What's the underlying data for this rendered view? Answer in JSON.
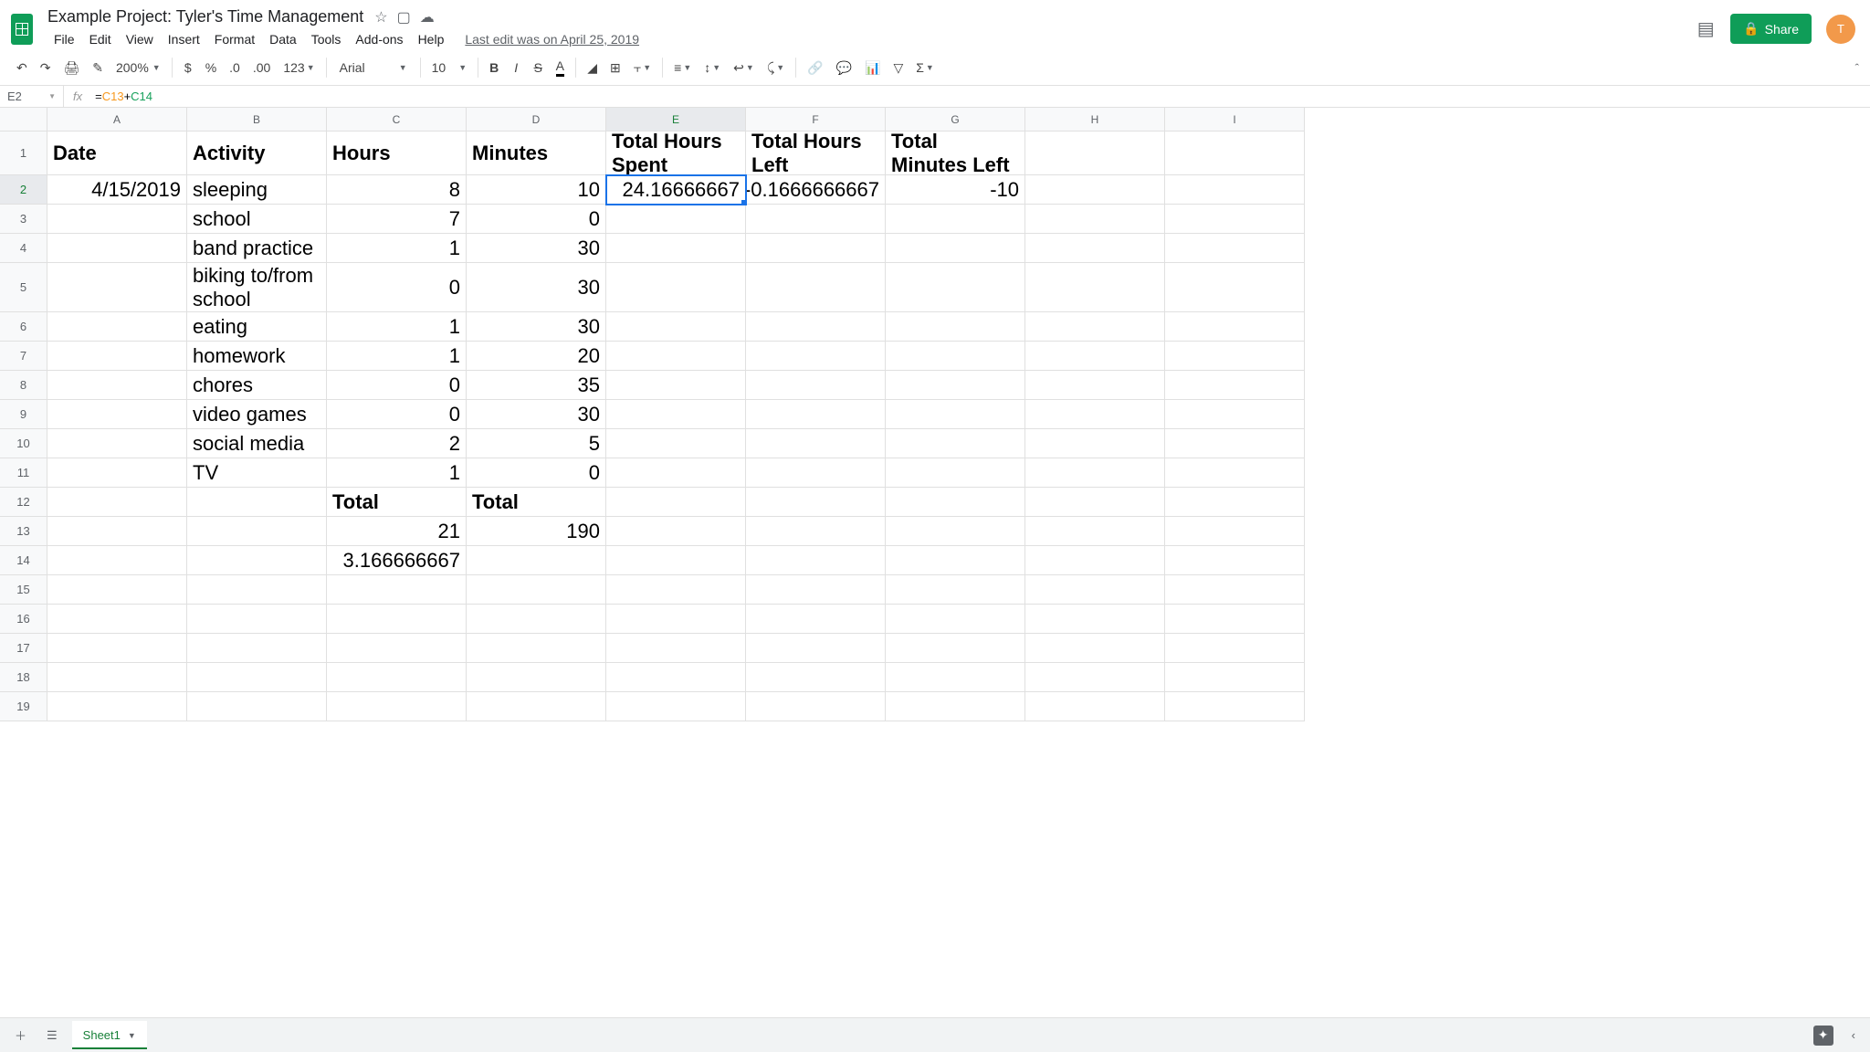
{
  "doc_title": "Example Project: Tyler's Time Management",
  "edit_info": "Last edit was on April 25, 2019",
  "menus": [
    "File",
    "Edit",
    "View",
    "Insert",
    "Format",
    "Data",
    "Tools",
    "Add-ons",
    "Help"
  ],
  "toolbar": {
    "zoom": "200%",
    "font": "Arial",
    "size": "10",
    "fmt": "123"
  },
  "name_box": "E2",
  "formula": {
    "p1": "=",
    "c1": "C13",
    "op": "+",
    "c2": "C14"
  },
  "share_label": "Share",
  "avatar_letter": "T",
  "columns": [
    "A",
    "B",
    "C",
    "D",
    "E",
    "F",
    "G",
    "H",
    "I"
  ],
  "rows": [
    {
      "n": 1,
      "h": "med",
      "cells": [
        {
          "v": "Date",
          "cls": "bold"
        },
        {
          "v": "Activity",
          "cls": "bold"
        },
        {
          "v": "Hours",
          "cls": "bold"
        },
        {
          "v": "Minutes",
          "cls": "bold"
        },
        {
          "v": "Total Hours Spent",
          "cls": "bold wrap"
        },
        {
          "v": "Total Hours Left",
          "cls": "bold wrap"
        },
        {
          "v": "Total Minutes Left",
          "cls": "bold wrap"
        },
        {
          "v": ""
        },
        {
          "v": ""
        }
      ]
    },
    {
      "n": 2,
      "cells": [
        {
          "v": "4/15/2019",
          "cls": "right"
        },
        {
          "v": "sleeping"
        },
        {
          "v": "8",
          "cls": "right"
        },
        {
          "v": "10",
          "cls": "right"
        },
        {
          "v": "24.16666667",
          "cls": "right",
          "sel": true
        },
        {
          "v": "-0.1666666667",
          "cls": "right"
        },
        {
          "v": "-10",
          "cls": "right"
        },
        {
          "v": ""
        },
        {
          "v": ""
        }
      ]
    },
    {
      "n": 3,
      "cells": [
        {
          "v": ""
        },
        {
          "v": "school"
        },
        {
          "v": "7",
          "cls": "right"
        },
        {
          "v": "0",
          "cls": "right"
        },
        {
          "v": ""
        },
        {
          "v": ""
        },
        {
          "v": ""
        },
        {
          "v": ""
        },
        {
          "v": ""
        }
      ]
    },
    {
      "n": 4,
      "cells": [
        {
          "v": ""
        },
        {
          "v": "band practice"
        },
        {
          "v": "1",
          "cls": "right"
        },
        {
          "v": "30",
          "cls": "right"
        },
        {
          "v": ""
        },
        {
          "v": ""
        },
        {
          "v": ""
        },
        {
          "v": ""
        },
        {
          "v": ""
        }
      ]
    },
    {
      "n": 5,
      "h": "tall",
      "cells": [
        {
          "v": ""
        },
        {
          "v": "biking to/from school",
          "cls": "wrap"
        },
        {
          "v": "0",
          "cls": "right"
        },
        {
          "v": "30",
          "cls": "right"
        },
        {
          "v": ""
        },
        {
          "v": ""
        },
        {
          "v": ""
        },
        {
          "v": ""
        },
        {
          "v": ""
        }
      ]
    },
    {
      "n": 6,
      "cells": [
        {
          "v": ""
        },
        {
          "v": "eating"
        },
        {
          "v": "1",
          "cls": "right"
        },
        {
          "v": "30",
          "cls": "right"
        },
        {
          "v": ""
        },
        {
          "v": ""
        },
        {
          "v": ""
        },
        {
          "v": ""
        },
        {
          "v": ""
        }
      ]
    },
    {
      "n": 7,
      "cells": [
        {
          "v": ""
        },
        {
          "v": "homework"
        },
        {
          "v": "1",
          "cls": "right"
        },
        {
          "v": "20",
          "cls": "right"
        },
        {
          "v": ""
        },
        {
          "v": ""
        },
        {
          "v": ""
        },
        {
          "v": ""
        },
        {
          "v": ""
        }
      ]
    },
    {
      "n": 8,
      "cells": [
        {
          "v": ""
        },
        {
          "v": "chores"
        },
        {
          "v": "0",
          "cls": "right"
        },
        {
          "v": "35",
          "cls": "right"
        },
        {
          "v": ""
        },
        {
          "v": ""
        },
        {
          "v": ""
        },
        {
          "v": ""
        },
        {
          "v": ""
        }
      ]
    },
    {
      "n": 9,
      "cells": [
        {
          "v": ""
        },
        {
          "v": "video games"
        },
        {
          "v": "0",
          "cls": "right"
        },
        {
          "v": "30",
          "cls": "right"
        },
        {
          "v": ""
        },
        {
          "v": ""
        },
        {
          "v": ""
        },
        {
          "v": ""
        },
        {
          "v": ""
        }
      ]
    },
    {
      "n": 10,
      "cells": [
        {
          "v": ""
        },
        {
          "v": "social media"
        },
        {
          "v": "2",
          "cls": "right"
        },
        {
          "v": "5",
          "cls": "right"
        },
        {
          "v": ""
        },
        {
          "v": ""
        },
        {
          "v": ""
        },
        {
          "v": ""
        },
        {
          "v": ""
        }
      ]
    },
    {
      "n": 11,
      "cells": [
        {
          "v": ""
        },
        {
          "v": "TV"
        },
        {
          "v": "1",
          "cls": "right"
        },
        {
          "v": "0",
          "cls": "right"
        },
        {
          "v": ""
        },
        {
          "v": ""
        },
        {
          "v": ""
        },
        {
          "v": ""
        },
        {
          "v": ""
        }
      ]
    },
    {
      "n": 12,
      "cells": [
        {
          "v": ""
        },
        {
          "v": ""
        },
        {
          "v": "Total",
          "cls": "bold"
        },
        {
          "v": "Total",
          "cls": "bold"
        },
        {
          "v": ""
        },
        {
          "v": ""
        },
        {
          "v": ""
        },
        {
          "v": ""
        },
        {
          "v": ""
        }
      ]
    },
    {
      "n": 13,
      "cells": [
        {
          "v": ""
        },
        {
          "v": ""
        },
        {
          "v": "21",
          "cls": "right"
        },
        {
          "v": "190",
          "cls": "right"
        },
        {
          "v": ""
        },
        {
          "v": ""
        },
        {
          "v": ""
        },
        {
          "v": ""
        },
        {
          "v": ""
        }
      ]
    },
    {
      "n": 14,
      "cells": [
        {
          "v": ""
        },
        {
          "v": ""
        },
        {
          "v": "3.166666667",
          "cls": "right"
        },
        {
          "v": ""
        },
        {
          "v": ""
        },
        {
          "v": ""
        },
        {
          "v": ""
        },
        {
          "v": ""
        },
        {
          "v": ""
        }
      ]
    },
    {
      "n": 15,
      "cells": [
        {
          "v": ""
        },
        {
          "v": ""
        },
        {
          "v": ""
        },
        {
          "v": ""
        },
        {
          "v": ""
        },
        {
          "v": ""
        },
        {
          "v": ""
        },
        {
          "v": ""
        },
        {
          "v": ""
        }
      ]
    },
    {
      "n": 16,
      "cells": [
        {
          "v": ""
        },
        {
          "v": ""
        },
        {
          "v": ""
        },
        {
          "v": ""
        },
        {
          "v": ""
        },
        {
          "v": ""
        },
        {
          "v": ""
        },
        {
          "v": ""
        },
        {
          "v": ""
        }
      ]
    },
    {
      "n": 17,
      "cells": [
        {
          "v": ""
        },
        {
          "v": ""
        },
        {
          "v": ""
        },
        {
          "v": ""
        },
        {
          "v": ""
        },
        {
          "v": ""
        },
        {
          "v": ""
        },
        {
          "v": ""
        },
        {
          "v": ""
        }
      ]
    },
    {
      "n": 18,
      "cells": [
        {
          "v": ""
        },
        {
          "v": ""
        },
        {
          "v": ""
        },
        {
          "v": ""
        },
        {
          "v": ""
        },
        {
          "v": ""
        },
        {
          "v": ""
        },
        {
          "v": ""
        },
        {
          "v": ""
        }
      ]
    },
    {
      "n": 19,
      "cells": [
        {
          "v": ""
        },
        {
          "v": ""
        },
        {
          "v": ""
        },
        {
          "v": ""
        },
        {
          "v": ""
        },
        {
          "v": ""
        },
        {
          "v": ""
        },
        {
          "v": ""
        },
        {
          "v": ""
        }
      ]
    }
  ],
  "sheet_tab": "Sheet1",
  "selected_col": "E",
  "selected_row": 2
}
